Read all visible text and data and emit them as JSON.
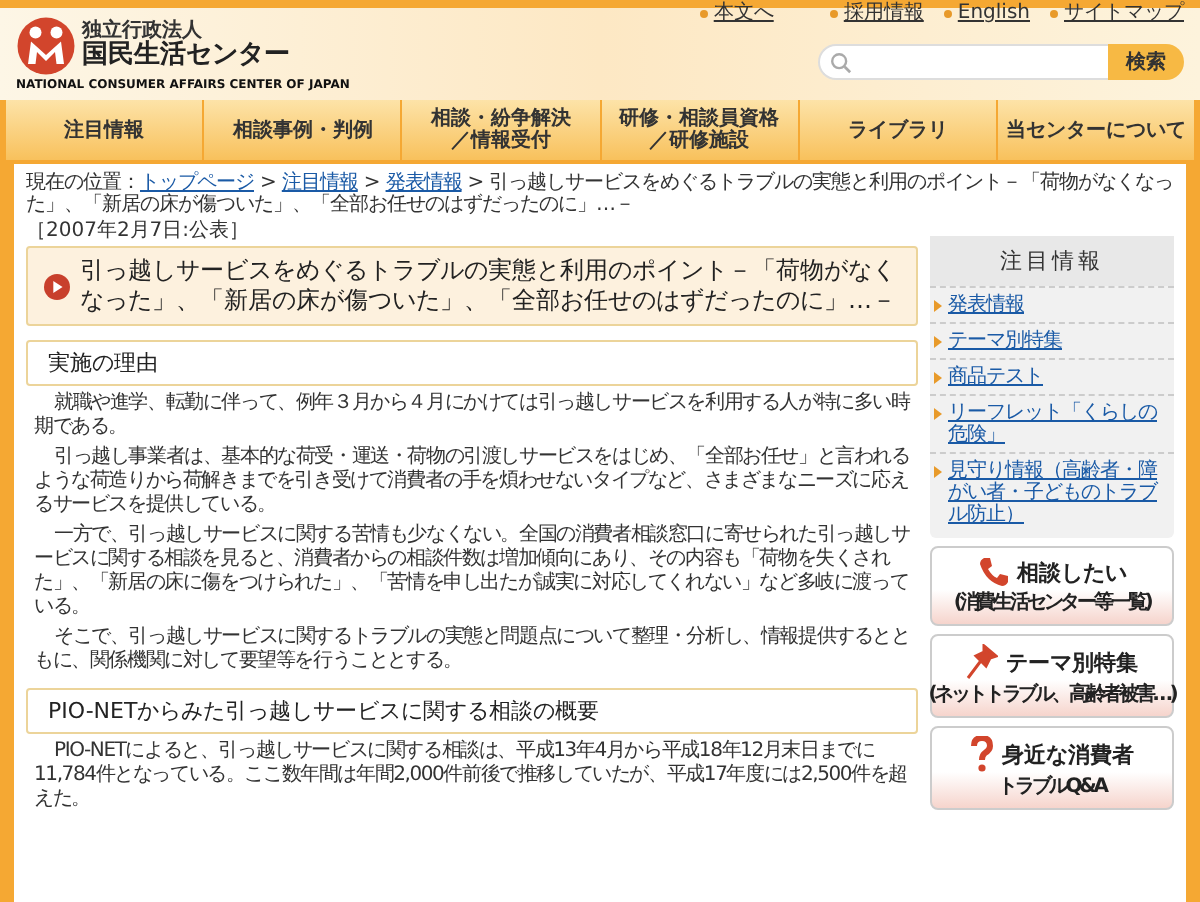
{
  "header": {
    "logo": {
      "org_type": "独立行政法人",
      "name": "国民生活センター",
      "name_en": "NATIONAL CONSUMER AFFAIRS CENTER OF JAPAN"
    },
    "top_links": [
      {
        "text": "本文へ"
      },
      {
        "text": "採用情報"
      },
      {
        "text": "English"
      },
      {
        "text": "サイトマップ"
      }
    ],
    "search": {
      "button": "検索"
    }
  },
  "nav": [
    {
      "lines": [
        "注目情報"
      ]
    },
    {
      "lines": [
        "相談事例・判例"
      ]
    },
    {
      "lines": [
        "相談・紛争解決",
        "／情報受付"
      ]
    },
    {
      "lines": [
        "研修・相談員資格",
        "／研修施設"
      ]
    },
    {
      "lines": [
        "ライブラリ"
      ]
    },
    {
      "lines": [
        "当センターについて"
      ]
    }
  ],
  "breadcrumb": {
    "label": "現在の位置：",
    "separator": ">",
    "links": [
      "トップページ",
      "注目情報",
      "発表情報"
    ],
    "current": "引っ越しサービスをめぐるトラブルの実態と利用のポイント－「荷物がなくなった」、「新居の床が傷ついた」、「全部お任せのはずだったのに」…－"
  },
  "date": "［2007年2月7日:公表］",
  "title": "引っ越しサービスをめぐるトラブルの実態と利用のポイント－「荷物がなくなった」、「新居の床が傷ついた」、「全部お任せのはずだったのに」…－",
  "sections": [
    {
      "heading": "実施の理由",
      "paragraphs": [
        "就職や進学、転勤に伴って、例年３月から４月にかけては引っ越しサービスを利用する人が特に多い時期である。",
        "引っ越し事業者は、基本的な荷受・運送・荷物の引渡しサービスをはじめ、「全部お任せ」と言われるような荷造りから荷解きまでを引き受けて消費者の手を煩わせないタイプなど、さまざまなニーズに応えるサービスを提供している。",
        "一方で、引っ越しサービスに関する苦情も少なくない。全国の消費者相談窓口に寄せられた引っ越しサービスに関する相談を見ると、消費者からの相談件数は増加傾向にあり、その内容も「荷物を失くされた」、「新居の床に傷をつけられた」、「苦情を申し出たが誠実に対応してくれない」など多岐に渡っている。",
        "そこで、引っ越しサービスに関するトラブルの実態と問題点について整理・分析し、情報提供するとともに、関係機関に対して要望等を行うこととする。"
      ]
    },
    {
      "heading": "PIO-NETからみた引っ越しサービスに関する相談の概要",
      "paragraphs": [
        "PIO-NETによると、引っ越しサービスに関する相談は、平成13年4月から平成18年12月末日までに11,784件となっている。ここ数年間は年間2,000件前後で推移していたが、平成17年度には2,500件を超えた。"
      ]
    }
  ],
  "sidebar": {
    "heading": "注目情報",
    "links": [
      {
        "text": "発表情報"
      },
      {
        "text": "テーマ別特集"
      },
      {
        "text": "商品テスト"
      },
      {
        "text": "リーフレット「くらしの危険」"
      },
      {
        "text": "見守り情報（高齢者・障がい者・子どものトラブル防止）"
      }
    ],
    "buttons": [
      {
        "kind": "phone",
        "title": "相談したい",
        "subtitle": "(消費生活センター等一覧)"
      },
      {
        "kind": "pin",
        "title": "テーマ別特集",
        "subtitle": "(ネットトラブル、高齢者被害…)"
      },
      {
        "kind": "question",
        "title": "身近な消費者",
        "subtitle": "トラブルQ&A"
      }
    ]
  }
}
